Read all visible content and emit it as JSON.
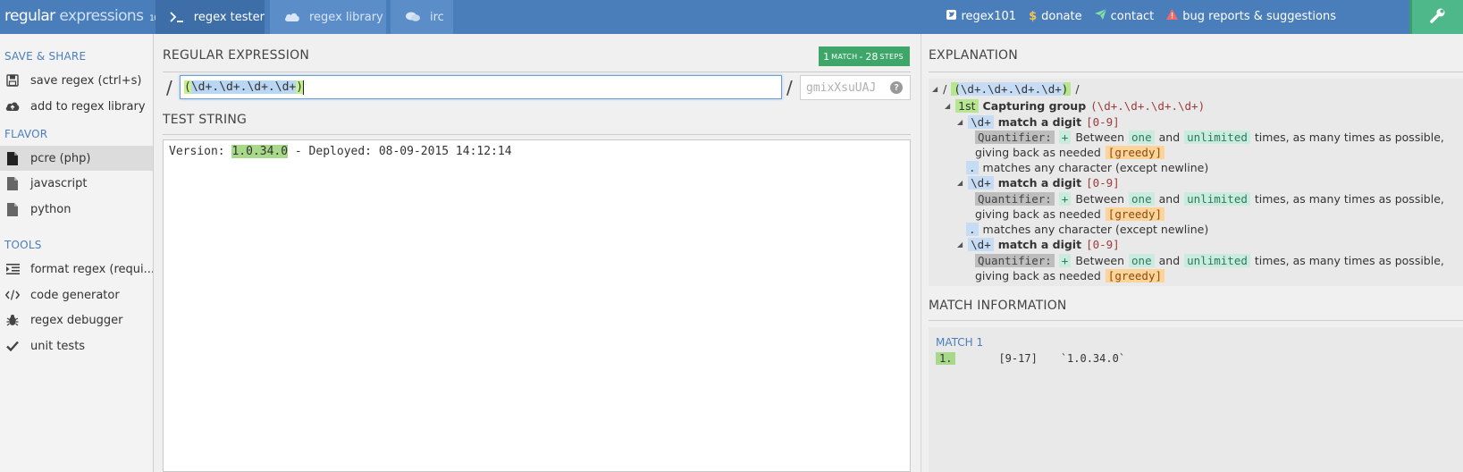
{
  "header": {
    "logo_part1": "regular",
    "logo_part2": "expressions",
    "logo_part3": "101",
    "tabs": [
      {
        "label": "regex tester",
        "icon": "terminal-icon",
        "active": true
      },
      {
        "label": "regex library",
        "icon": "cloud-icon",
        "active": false
      },
      {
        "label": "irc",
        "icon": "chat-icon",
        "active": false
      }
    ],
    "links": [
      {
        "label": "regex101",
        "icon": "twitter-icon"
      },
      {
        "label": "donate",
        "icon": "dollar-icon"
      },
      {
        "label": "contact",
        "icon": "paper-plane-icon"
      },
      {
        "label": "bug reports & suggestions",
        "icon": "warning-icon"
      }
    ],
    "wrench_icon": "wrench-icon",
    "colors": {
      "bar": "#4a7ebb",
      "active_tab": "#3d6ea8",
      "wrench_bg": "#4fb88a"
    }
  },
  "sidebar": {
    "save_share_heading": "SAVE & SHARE",
    "save_items": [
      {
        "label": "save regex (ctrl+s)",
        "icon": "floppy-icon"
      },
      {
        "label": "add to regex library",
        "icon": "cloud-upload-icon"
      }
    ],
    "flavor_heading": "FLAVOR",
    "flavor_items": [
      {
        "label": "pcre (php)",
        "icon": "file-icon",
        "active": true
      },
      {
        "label": "javascript",
        "icon": "file-icon",
        "active": false
      },
      {
        "label": "python",
        "icon": "file-icon",
        "active": false
      }
    ],
    "tools_heading": "TOOLS",
    "tool_items": [
      {
        "label": "format regex (requi...",
        "icon": "indent-icon"
      },
      {
        "label": "code generator",
        "icon": "code-icon"
      },
      {
        "label": "regex debugger",
        "icon": "bug-icon"
      },
      {
        "label": "unit tests",
        "icon": "check-icon"
      }
    ]
  },
  "editor": {
    "regex_heading": "REGULAR EXPRESSION",
    "match_badge": {
      "count": "1",
      "word_match": "MATCH",
      "sep": "-",
      "steps": "28",
      "word_steps": "STEPS"
    },
    "delimiter": "/",
    "regex": {
      "open": "(",
      "body": "\\d+.\\d+.\\d+.\\d+",
      "close": ")"
    },
    "flags_placeholder": "gmixXsuUAJ",
    "help_label": "?",
    "test_heading": "TEST STRING",
    "test_string": {
      "before": "Version: ",
      "match": "1.0.34.0",
      "after": " - Deployed: 08-09-2015 14:12:14"
    }
  },
  "explanation": {
    "heading": "EXPLANATION",
    "root": {
      "slash1": "/",
      "expr": "(\\d+.\\d+.\\d+.\\d+)",
      "slash2": "/"
    },
    "group": {
      "ordinal": "1st",
      "label": "Capturing group",
      "expr": "(\\d+.\\d+.\\d+.\\d+)"
    },
    "digit_token": "\\d+",
    "digit_label": "match a digit",
    "digit_range": "[0-9]",
    "quantifier_label": "Quantifier:",
    "plus": "+",
    "between": "Between",
    "one": "one",
    "and": "and",
    "unlimited": "unlimited",
    "times_text": "times, as many times as possible,",
    "giving_back": "giving back as needed",
    "greedy": "[greedy]",
    "dot_token": ".",
    "dot_label": "matches any character (except newline)"
  },
  "match_info": {
    "heading": "MATCH INFORMATION",
    "match_title": "MATCH 1",
    "rows": [
      {
        "num": "1.",
        "range": "[9-17]",
        "value": "`1.0.34.0`"
      }
    ]
  }
}
